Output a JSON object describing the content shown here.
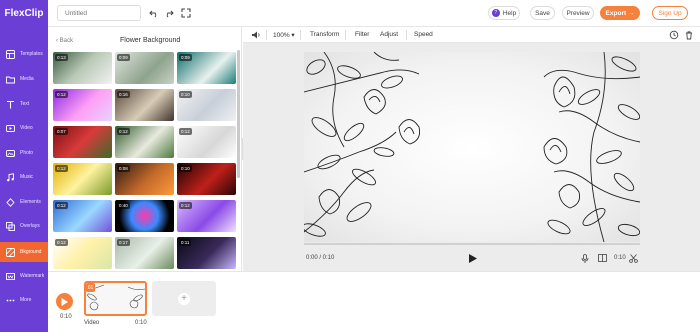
{
  "app": {
    "logo_text": "FlexClip"
  },
  "header": {
    "title_placeholder": "Untitled",
    "help_label": "Help",
    "save_label": "Save",
    "preview_label": "Preview",
    "export_label": "Export →",
    "signup_label": "Sign Up"
  },
  "sidebar": {
    "items": [
      {
        "label": "Templates",
        "icon": "templates-icon"
      },
      {
        "label": "Media",
        "icon": "media-icon"
      },
      {
        "label": "Text",
        "icon": "text-icon"
      },
      {
        "label": "Video",
        "icon": "video-icon"
      },
      {
        "label": "Photo",
        "icon": "photo-icon"
      },
      {
        "label": "Music",
        "icon": "music-icon"
      },
      {
        "label": "Elements",
        "icon": "elements-icon"
      },
      {
        "label": "Overlays",
        "icon": "overlays-icon"
      },
      {
        "label": "Bkground",
        "icon": "background-icon",
        "active": true
      },
      {
        "label": "Watermark",
        "icon": "watermark-icon"
      },
      {
        "label": "More",
        "icon": "more-icon"
      }
    ]
  },
  "library": {
    "back_label": "Back",
    "title": "Flower Background",
    "thumbnails": [
      {
        "duration": "0:13"
      },
      {
        "duration": "0:09"
      },
      {
        "duration": "0:09"
      },
      {
        "duration": "0:12"
      },
      {
        "duration": "0:16"
      },
      {
        "duration": "0:10"
      },
      {
        "duration": "0:07"
      },
      {
        "duration": "0:12"
      },
      {
        "duration": "0:12"
      },
      {
        "duration": "0:12"
      },
      {
        "duration": "0:08"
      },
      {
        "duration": "0:10"
      },
      {
        "duration": "0:12"
      },
      {
        "duration": "0:40"
      },
      {
        "duration": "0:12"
      },
      {
        "duration": "0:12"
      },
      {
        "duration": "0:17"
      },
      {
        "duration": "0:11"
      }
    ]
  },
  "toolbar": {
    "zoom": "100%",
    "transform_label": "Transform",
    "filter_label": "Filter",
    "adjust_label": "Adjust",
    "speed_label": "Speed"
  },
  "player": {
    "current_time": "0:00 / 0:10",
    "end_time": "0:10",
    "progress": 0
  },
  "timeline": {
    "time": "0:10",
    "clip_number": "01",
    "clip_label": "Video",
    "clip_duration": "0:10"
  },
  "colors": {
    "brand_purple": "#6b3fd6",
    "accent_orange": "#f5813c",
    "active_item": "#f0672f"
  }
}
